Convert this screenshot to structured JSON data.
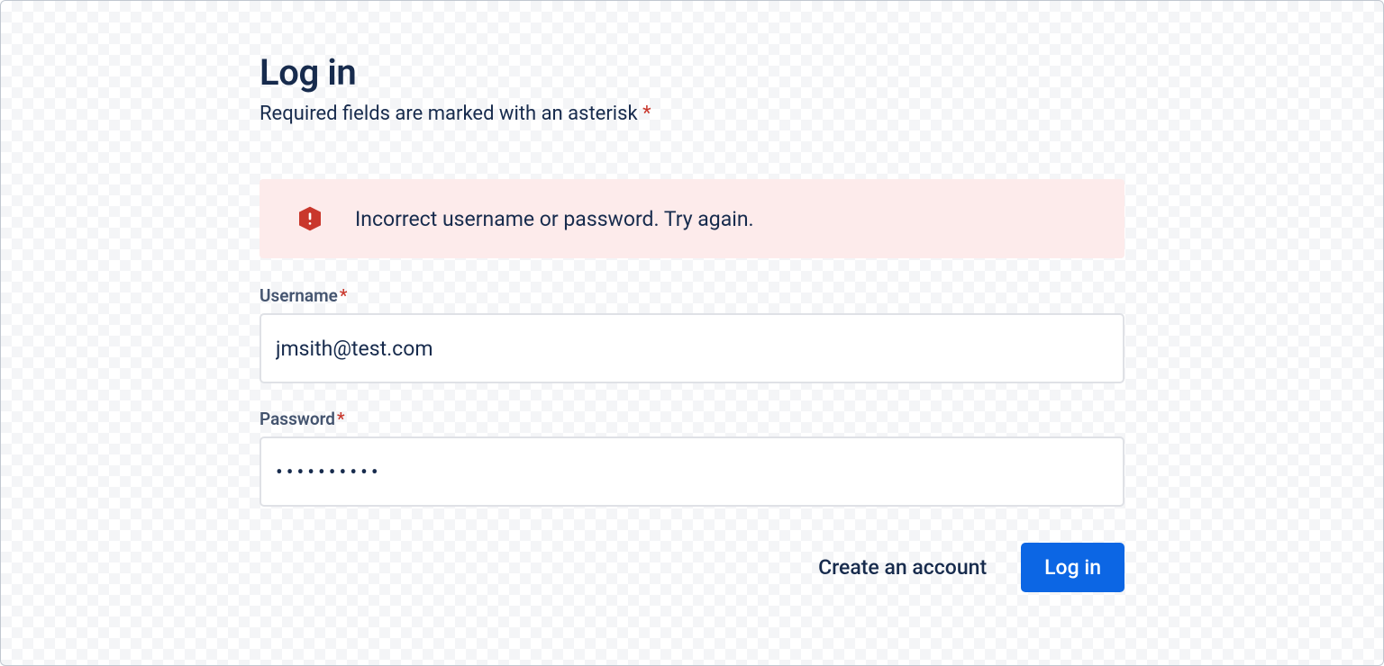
{
  "header": {
    "title": "Log in",
    "subtitle_prefix": "Required fields are marked with an asterisk ",
    "subtitle_asterisk": "*"
  },
  "alert": {
    "message": "Incorrect username or password. Try again."
  },
  "fields": {
    "username": {
      "label": "Username",
      "required_mark": "*",
      "value": "jmsith@test.com"
    },
    "password": {
      "label": "Password",
      "required_mark": "*",
      "value": "••••••••••"
    }
  },
  "actions": {
    "create_account_label": "Create an account",
    "login_label": "Log in"
  },
  "colors": {
    "text_primary": "#172B4D",
    "text_subtle": "#44546F",
    "danger": "#C9372C",
    "danger_bg": "#FDEBEB",
    "primary_button": "#0C66E4",
    "border": "#dfe1e6"
  }
}
